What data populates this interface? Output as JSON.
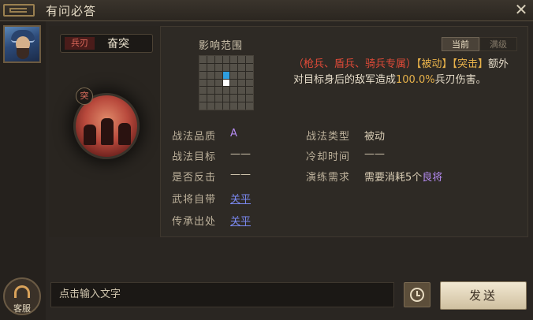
{
  "window": {
    "title": "有问必答"
  },
  "skill": {
    "type_badge": "兵刃",
    "name": "奋突",
    "icon_mark": "突"
  },
  "range": {
    "label": "影响范围",
    "rows": [
      [
        "empty",
        "empty",
        "empty",
        "empty",
        "empty",
        "empty",
        "empty"
      ],
      [
        "empty",
        "empty",
        "empty",
        "empty",
        "empty",
        "empty",
        "empty"
      ],
      [
        "empty",
        "empty",
        "empty",
        "hit",
        "empty",
        "empty",
        "empty"
      ],
      [
        "empty",
        "empty",
        "empty",
        "self",
        "empty",
        "empty",
        "empty"
      ],
      [
        "empty",
        "empty",
        "empty",
        "empty",
        "empty",
        "empty",
        "empty"
      ],
      [
        "empty",
        "empty",
        "empty",
        "empty",
        "empty",
        "empty",
        "empty"
      ],
      [
        "empty",
        "empty",
        "empty",
        "empty",
        "empty",
        "empty",
        "empty"
      ]
    ]
  },
  "tabs": {
    "current": "当前",
    "max_level": "满级"
  },
  "description": {
    "restriction": "（枪兵、盾兵、骑兵专属）",
    "tag_passive": "【被动】",
    "tag_assault": "【突击】",
    "line1_tail": "额外",
    "line2_prefix": "对目标身后的敌军造成",
    "percent": "100.0%",
    "line2_suffix": "兵刃伤害。"
  },
  "attributes": {
    "quality": {
      "label": "战法品质",
      "value": "A"
    },
    "type": {
      "label": "战法类型",
      "value": "被动"
    },
    "target": {
      "label": "战法目标",
      "value": "——"
    },
    "cooldown": {
      "label": "冷却时间",
      "value": "——"
    },
    "counter": {
      "label": "是否反击",
      "value": "——"
    },
    "training": {
      "label": "演练需求",
      "value_prefix": "需要消耗",
      "count": "5个",
      "general": "良将"
    },
    "innate": {
      "label": "武将自带",
      "value": "关平"
    },
    "inherit": {
      "label": "传承出处",
      "value": "关平"
    }
  },
  "chat": {
    "placeholder": "点击输入文字",
    "send": "发送",
    "service": "客服"
  },
  "colors": {
    "accent_red": "#e04a38",
    "accent_gold": "#e8b24a",
    "link_blue": "#7a88f0",
    "purple": "#b48af0"
  }
}
